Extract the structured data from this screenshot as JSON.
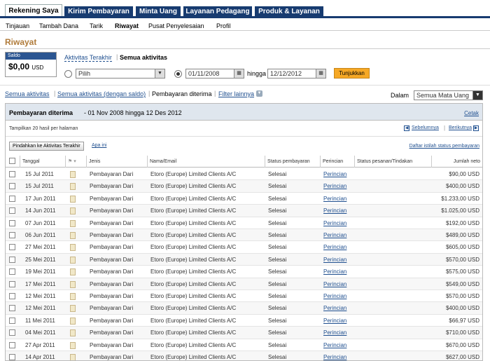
{
  "tabs": [
    "Rekening Saya",
    "Kirim Pembayaran",
    "Minta Uang",
    "Layanan Pedagang",
    "Produk & Layanan"
  ],
  "subnav": [
    "Tinjauan",
    "Tambah Dana",
    "Tarik",
    "Riwayat",
    "Pusat Penyelesaian",
    "Profil"
  ],
  "page_title": "Riwayat",
  "saldo": {
    "label": "Saldo",
    "amount": "$0,00",
    "currency": "USD"
  },
  "activity_links": {
    "recent": "Aktivitas Terakhir",
    "all": "Semua aktivitas"
  },
  "filter": {
    "select_value": "Pilih",
    "date_from": "01/11/2008",
    "until": "hingga",
    "date_to": "12/12/2012",
    "show_button": "Tunjukkan"
  },
  "view_links": {
    "all": "Semua aktivitas",
    "all_balance": "Semua aktivitas (dengan saldo)",
    "received": "Pembayaran diterima",
    "more": "Filter lainnya",
    "in_label": "Dalam",
    "currency_select": "Semua Mata Uang"
  },
  "panel": {
    "title": "Pembayaran diterima",
    "range": "- 01 Nov 2008 hingga 12 Des 2012",
    "print": "Cetak",
    "per_page": "Tampilkan 20 hasil per halaman",
    "prev": "Sebelumnya",
    "next": "Berikutnya",
    "move_button": "Pindahkan ke Aktivitas Terakhir",
    "what": "Apa ini",
    "glossary": "Daftar istilah status pembayaran"
  },
  "columns": [
    "Tanggal",
    "Jenis",
    "Nama/Email",
    "Status pembayaran",
    "Perincian",
    "Status pesanan/Tindakan",
    "Jumlah neto"
  ],
  "rows": [
    {
      "date": "15 Jul 2011",
      "type": "Pembayaran Dari",
      "name": "Etoro (Europe) Limited Clients A/C",
      "status": "Selesai",
      "detail": "Perincian",
      "amount": "$90,00 USD"
    },
    {
      "date": "15 Jul 2011",
      "type": "Pembayaran Dari",
      "name": "Etoro (Europe) Limited Clients A/C",
      "status": "Selesai",
      "detail": "Perincian",
      "amount": "$400,00 USD"
    },
    {
      "date": "17 Jun 2011",
      "type": "Pembayaran Dari",
      "name": "Etoro (Europe) Limited Clients A/C",
      "status": "Selesai",
      "detail": "Perincian",
      "amount": "$1.233,00 USD"
    },
    {
      "date": "14 Jun 2011",
      "type": "Pembayaran Dari",
      "name": "Etoro (Europe) Limited Clients A/C",
      "status": "Selesai",
      "detail": "Perincian",
      "amount": "$1.025,00 USD"
    },
    {
      "date": "07 Jun 2011",
      "type": "Pembayaran Dari",
      "name": "Etoro (Europe) Limited Clients A/C",
      "status": "Selesai",
      "detail": "Perincian",
      "amount": "$192,00 USD"
    },
    {
      "date": "06 Jun 2011",
      "type": "Pembayaran Dari",
      "name": "Etoro (Europe) Limited Clients A/C",
      "status": "Selesai",
      "detail": "Perincian",
      "amount": "$489,00 USD"
    },
    {
      "date": "27 Mei 2011",
      "type": "Pembayaran Dari",
      "name": "Etoro (Europe) Limited Clients A/C",
      "status": "Selesai",
      "detail": "Perincian",
      "amount": "$605,00 USD"
    },
    {
      "date": "25 Mei 2011",
      "type": "Pembayaran Dari",
      "name": "Etoro (Europe) Limited Clients A/C",
      "status": "Selesai",
      "detail": "Perincian",
      "amount": "$570,00 USD"
    },
    {
      "date": "19 Mei 2011",
      "type": "Pembayaran Dari",
      "name": "Etoro (Europe) Limited Clients A/C",
      "status": "Selesai",
      "detail": "Perincian",
      "amount": "$575,00 USD"
    },
    {
      "date": "17 Mei 2011",
      "type": "Pembayaran Dari",
      "name": "Etoro (Europe) Limited Clients A/C",
      "status": "Selesai",
      "detail": "Perincian",
      "amount": "$549,00 USD"
    },
    {
      "date": "12 Mei 2011",
      "type": "Pembayaran Dari",
      "name": "Etoro (Europe) Limited Clients A/C",
      "status": "Selesai",
      "detail": "Perincian",
      "amount": "$570,00 USD"
    },
    {
      "date": "12 Mei 2011",
      "type": "Pembayaran Dari",
      "name": "Etoro (Europe) Limited Clients A/C",
      "status": "Selesai",
      "detail": "Perincian",
      "amount": "$400,00 USD"
    },
    {
      "date": "11 Mei 2011",
      "type": "Pembayaran Dari",
      "name": "Etoro (Europe) Limited Clients A/C",
      "status": "Selesai",
      "detail": "Perincian",
      "amount": "$66,97 USD"
    },
    {
      "date": "04 Mei 2011",
      "type": "Pembayaran Dari",
      "name": "Etoro (Europe) Limited Clients A/C",
      "status": "Selesai",
      "detail": "Perincian",
      "amount": "$710,00 USD"
    },
    {
      "date": "27 Apr 2011",
      "type": "Pembayaran Dari",
      "name": "Etoro (Europe) Limited Clients A/C",
      "status": "Selesai",
      "detail": "Perincian",
      "amount": "$670,00 USD"
    },
    {
      "date": "14 Apr 2011",
      "type": "Pembayaran Dari",
      "name": "Etoro (Europe) Limited Clients A/C",
      "status": "Selesai",
      "detail": "Perincian",
      "amount": "$627,00 USD"
    }
  ]
}
